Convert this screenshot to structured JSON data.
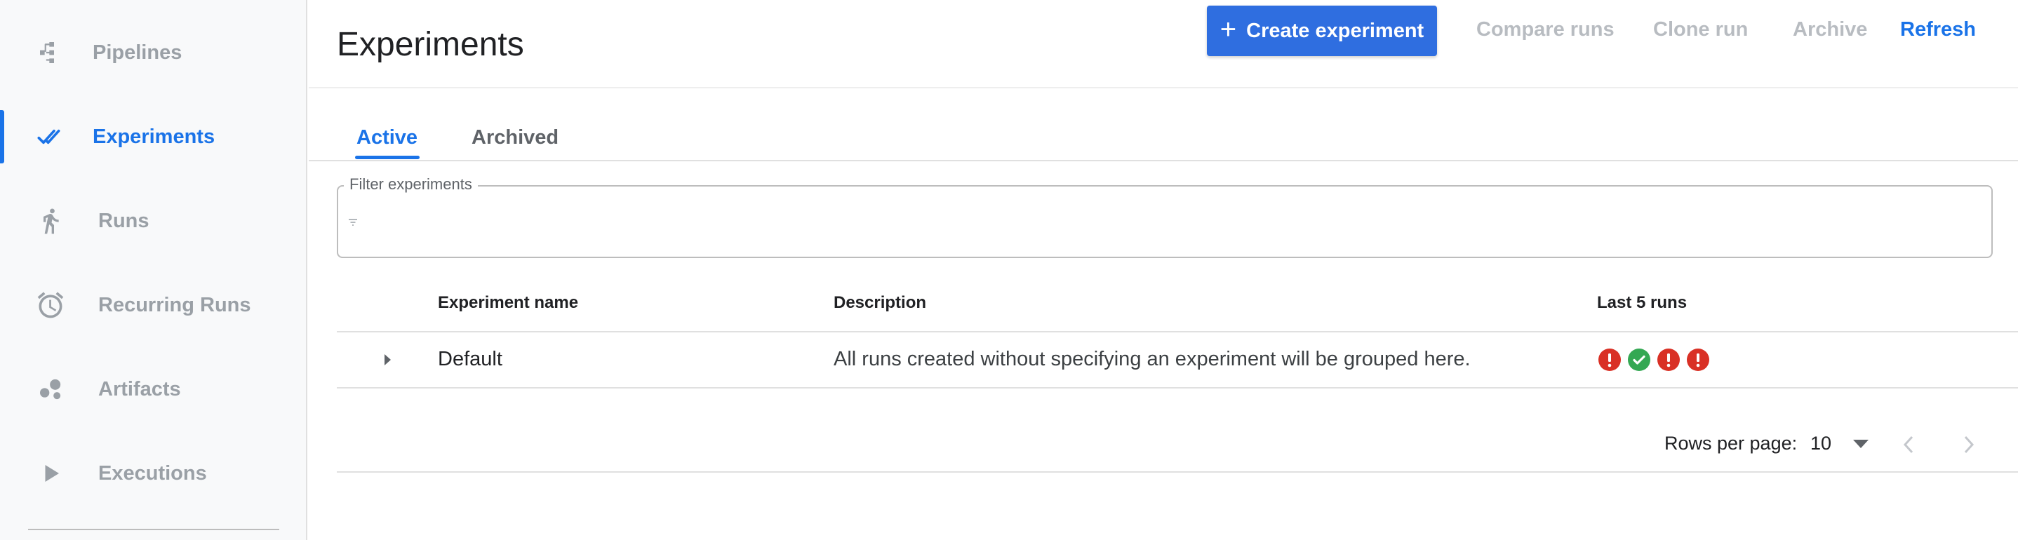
{
  "sidebar": {
    "items": [
      {
        "label": "Pipelines",
        "icon": "pipelines-icon",
        "active": false
      },
      {
        "label": "Experiments",
        "icon": "experiments-icon",
        "active": true
      },
      {
        "label": "Runs",
        "icon": "runs-icon",
        "active": false
      },
      {
        "label": "Recurring Runs",
        "icon": "alarm-clock-icon",
        "active": false
      },
      {
        "label": "Artifacts",
        "icon": "artifacts-icon",
        "active": false
      },
      {
        "label": "Executions",
        "icon": "play-icon",
        "active": false
      }
    ]
  },
  "header": {
    "title": "Experiments",
    "toolbar": {
      "create_label": "Create experiment",
      "compare_label": "Compare runs",
      "clone_label": "Clone run",
      "archive_label": "Archive",
      "refresh_label": "Refresh"
    }
  },
  "tabs": [
    {
      "label": "Active",
      "active": true
    },
    {
      "label": "Archived",
      "active": false
    }
  ],
  "filter": {
    "label": "Filter experiments",
    "value": ""
  },
  "table": {
    "columns": [
      "Experiment name",
      "Description",
      "Last 5 runs"
    ],
    "rows": [
      {
        "name": "Default",
        "description": "All runs created without specifying an experiment will be grouped here.",
        "last_runs": [
          "error",
          "success",
          "error",
          "error"
        ]
      }
    ]
  },
  "pagination": {
    "rows_per_page_label": "Rows per page:",
    "rows_per_page": "10"
  },
  "colors": {
    "accent": "#1a73e8",
    "primary_button": "#2f6ee0",
    "error": "#d93025",
    "success": "#34a853",
    "disabled_text": "#b8bcc1"
  }
}
